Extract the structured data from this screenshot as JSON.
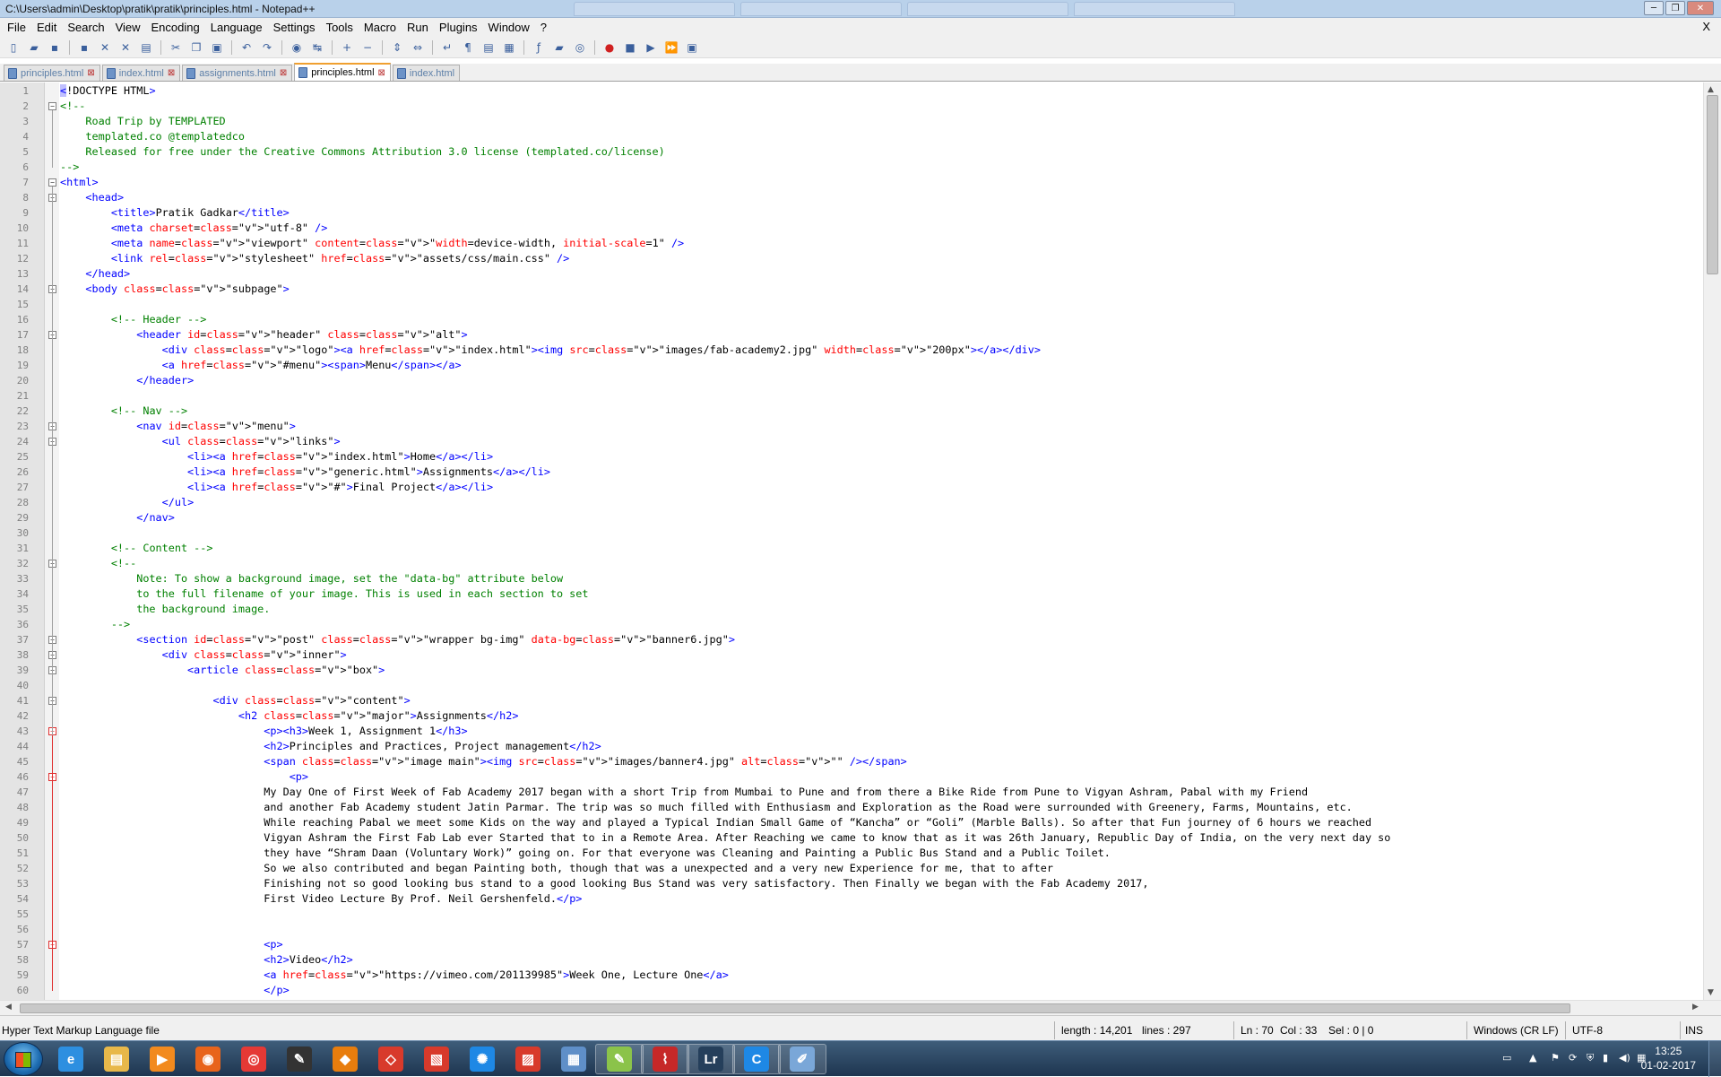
{
  "window": {
    "title": "C:\\Users\\admin\\Desktop\\pratik\\pratik\\principles.html - Notepad++"
  },
  "menu": [
    "File",
    "Edit",
    "Search",
    "View",
    "Encoding",
    "Language",
    "Settings",
    "Tools",
    "Macro",
    "Run",
    "Plugins",
    "Window",
    "?"
  ],
  "menu_close": "X",
  "toolbar_icons": [
    "new-file-icon",
    "open-file-icon",
    "save-icon",
    "save-all-icon",
    "close-icon",
    "close-all-icon",
    "print-icon",
    "cut-icon",
    "copy-icon",
    "paste-icon",
    "undo-icon",
    "redo-icon",
    "find-icon",
    "replace-icon",
    "zoom-in-icon",
    "zoom-out-icon",
    "sync-vertical-icon",
    "sync-horizontal-icon",
    "word-wrap-icon",
    "all-chars-icon",
    "indent-guide-icon",
    "doc-map-icon",
    "function-list-icon",
    "folder-workspace-icon",
    "monitoring-icon",
    "record-macro-icon",
    "stop-macro-icon",
    "play-macro-icon",
    "run-macro-multiple-icon",
    "save-macro-icon"
  ],
  "tabs": [
    {
      "label": "principles.html",
      "active": false
    },
    {
      "label": "index.html",
      "active": false
    },
    {
      "label": "assignments.html",
      "active": false
    },
    {
      "label": "principles.html",
      "active": true
    },
    {
      "label": "index.html",
      "active": false
    }
  ],
  "editor": {
    "lines": [
      "<!DOCTYPE HTML>",
      "<!--",
      "    Road Trip by TEMPLATED",
      "    templated.co @templatedco",
      "    Released for free under the Creative Commons Attribution 3.0 license (templated.co/license)",
      "-->",
      "<html>",
      "    <head>",
      "        <title>Pratik Gadkar</title>",
      "        <meta charset=\"utf-8\" />",
      "        <meta name=\"viewport\" content=\"width=device-width, initial-scale=1\" />",
      "        <link rel=\"stylesheet\" href=\"assets/css/main.css\" />",
      "    </head>",
      "    <body class=\"subpage\">",
      "",
      "        <!-- Header -->",
      "            <header id=\"header\" class=\"alt\">",
      "                <div class=\"logo\"><a href=\"index.html\"><img src=\"images/fab-academy2.jpg\" width=\"200px\"></a></div>",
      "                <a href=\"#menu\"><span>Menu</span></a>",
      "            </header>",
      "",
      "        <!-- Nav -->",
      "            <nav id=\"menu\">",
      "                <ul class=\"links\">",
      "                    <li><a href=\"index.html\">Home</a></li>",
      "                    <li><a href=\"generic.html\">Assignments</a></li>",
      "                    <li><a href=\"#\">Final Project</a></li>",
      "                </ul>",
      "            </nav>",
      "",
      "        <!-- Content -->",
      "        <!--",
      "            Note: To show a background image, set the \"data-bg\" attribute below",
      "            to the full filename of your image. This is used in each section to set",
      "            the background image.",
      "        -->",
      "            <section id=\"post\" class=\"wrapper bg-img\" data-bg=\"banner6.jpg\">",
      "                <div class=\"inner\">",
      "                    <article class=\"box\">",
      "",
      "                        <div class=\"content\">",
      "                            <h2 class=\"major\">Assignments</h2>",
      "                                <p><h3>Week 1, Assignment 1</h3>",
      "                                <h2>Principles and Practices, Project management</h2>",
      "                                <span class=\"image main\"><img src=\"images/banner4.jpg\" alt=\"\" /></span>",
      "                                    <p>",
      "                                My Day One of First Week of Fab Academy 2017 began with a short Trip from Mumbai to Pune and from there a Bike Ride from Pune to Vigyan Ashram, Pabal with my Friend",
      "                                and another Fab Academy student Jatin Parmar. The trip was so much filled with Enthusiasm and Exploration as the Road were surrounded with Greenery, Farms, Mountains, etc.",
      "                                While reaching Pabal we meet some Kids on the way and played a Typical Indian Small Game of “Kancha” or “Goli” (Marble Balls). So after that Fun journey of 6 hours we reached",
      "                                Vigyan Ashram the First Fab Lab ever Started that to in a Remote Area. After Reaching we came to know that as it was 26th January, Republic Day of India, on the very next day so",
      "                                they have “Shram Daan (Voluntary Work)” going on. For that everyone was Cleaning and Painting a Public Bus Stand and a Public Toilet.",
      "                                So we also contributed and began Painting both, though that was a unexpected and a very new Experience for me, that to after",
      "                                Finishing not so good looking bus stand to a good looking Bus Stand was very satisfactory. Then Finally we began with the Fab Academy 2017,",
      "                                First Video Lecture By Prof. Neil Gershenfeld.</p>",
      "",
      "",
      "                                <p>",
      "                                <h2>Video</h2>",
      "                                <a href=\"https://vimeo.com/201139985\">Week One, Lecture One</a>",
      "                                </p>"
    ]
  },
  "status": {
    "language": "Hyper Text Markup Language file",
    "length": "length : 14,201",
    "lines": "lines : 297",
    "ln": "Ln : 70",
    "col": "Col : 33",
    "sel": "Sel : 0 | 0",
    "eol": "Windows (CR LF)",
    "encoding": "UTF-8",
    "mode": "INS"
  },
  "taskbar": {
    "apps": [
      "ie-icon",
      "explorer-icon",
      "media-player-icon",
      "firefox-icon",
      "chrome-icon",
      "inkscape-icon",
      "blender-icon",
      "sketchup-icon",
      "sketchup-layout-icon",
      "network-icon",
      "sketchup-style-icon",
      "control-panel-icon",
      "notepadpp-icon",
      "acrobat-icon",
      "lightroom-icon",
      "ccleaner-icon",
      "paint-icon"
    ],
    "lightroom_label": "Lr",
    "ccleaner_label": "C",
    "time": "13:25",
    "date": "01-02-2017"
  },
  "colors": {
    "tag": "#0000ff",
    "attr": "#ff0000",
    "value": "#8000ff",
    "comment": "#008000",
    "gutter": "#e4e4e4",
    "active_tab": "#f0a030"
  }
}
